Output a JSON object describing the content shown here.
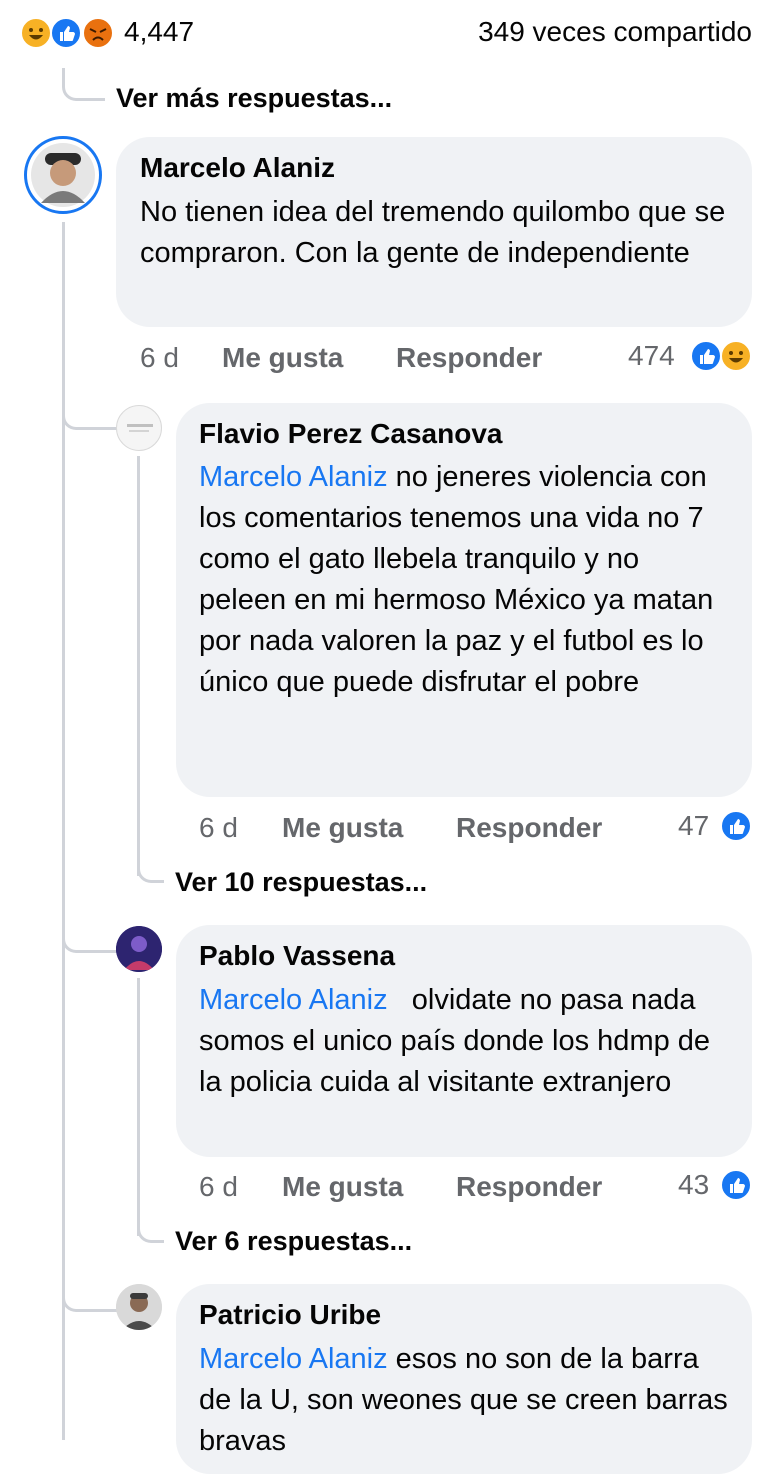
{
  "top_bar": {
    "reaction_count": "4,447",
    "shares": "349 veces compartido",
    "reaction_icons": [
      "haha-icon",
      "like-icon",
      "angry-icon"
    ]
  },
  "thread_more": "Ver más respuestas...",
  "comments": [
    {
      "author": "Marcelo Alaniz",
      "text": "No tienen idea del tremendo quilombo que se compraron. Con la gente de independiente",
      "time": "6 d",
      "like": "Me gusta",
      "reply": "Responder",
      "reactions": "474"
    },
    {
      "author": "Flavio Perez Casanova",
      "mention": "Marcelo Alaniz",
      "text": " no jeneres violencia con los comentarios tenemos una vida no 7 como el gato llebela tranquilo y no peleen en mi hermoso México ya matan por nada valoren la paz y el futbol es lo único que puede disfrutar el pobre",
      "time": "6 d",
      "like": "Me gusta",
      "reply": "Responder",
      "reactions": "47",
      "more_replies": "Ver 10 respuestas..."
    },
    {
      "author": "Pablo Vassena",
      "mention": "Marcelo Alaniz",
      "text": "   olvidate no pasa nada somos el unico país donde los hdmp de la policia cuida al visitante extranjero",
      "time": "6 d",
      "like": "Me gusta",
      "reply": "Responder",
      "reactions": "43",
      "more_replies": "Ver 6 respuestas..."
    },
    {
      "author": "Patricio Uribe",
      "mention": "Marcelo Alaniz",
      "text": " esos no son de la barra de la U, son weones que se creen barras bravas"
    }
  ],
  "colors": {
    "link": "#1877f2",
    "bubble": "#f0f2f5",
    "meta": "#65676b",
    "thread_line": "#d0d3d9",
    "like": "#1877f2",
    "haha": "#f7b125",
    "angry": "#e9710f"
  }
}
